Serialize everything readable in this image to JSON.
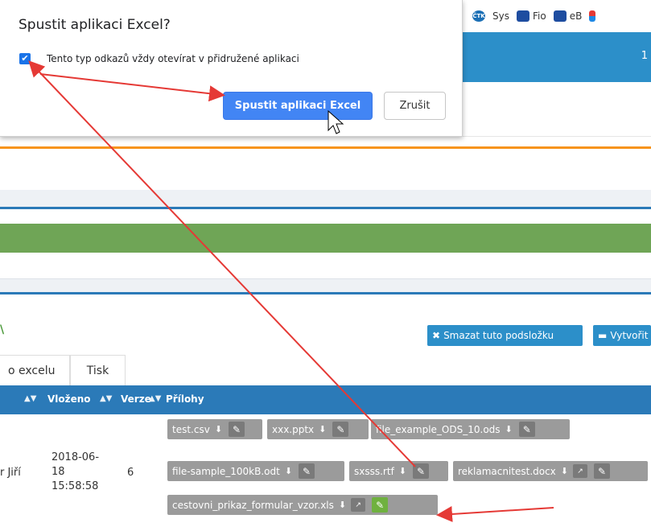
{
  "bookmarks": [
    {
      "icon": "ctk-icon",
      "label": "ČTK"
    },
    {
      "icon": "bookmark-icon",
      "label": "Sys"
    },
    {
      "icon": "fio-icon",
      "label": "Fio"
    },
    {
      "icon": "fio-icon",
      "label": "eB"
    }
  ],
  "header": {
    "number": "1"
  },
  "dialog": {
    "title": "Spustit aplikaci Excel?",
    "checkbox_label": "Tento typ odkazů vždy otevírat v přidružené aplikaci",
    "checkbox_checked": true,
    "ok_label": "Spustit aplikaci Excel",
    "cancel_label": "Zrušit"
  },
  "folder": {
    "delete_label": "Smazat tuto podsložku",
    "create_label": "Vytvořit"
  },
  "tabs": [
    "o excelu",
    "Tisk"
  ],
  "table": {
    "columns": [
      "Vloženo",
      "Verze",
      "Přílohy"
    ],
    "row": {
      "name": "r Jiří",
      "date": "2018-06-18",
      "time": "15:58:58",
      "version": "6"
    },
    "attachments": [
      "test.csv",
      "xxx.pptx",
      "file_example_ODS_10.ods",
      "file-sample_100kB.odt",
      "sxsss.rtf",
      "reklamacnitest.docx",
      "cestovni_prikaz_formular_vzor.xls"
    ]
  },
  "colors": {
    "accent_blue": "#2c8fc9",
    "header_blue": "#2b7ab8",
    "green": "#6fa556",
    "dialog_primary": "#4285f4",
    "arrow": "#e53935"
  }
}
